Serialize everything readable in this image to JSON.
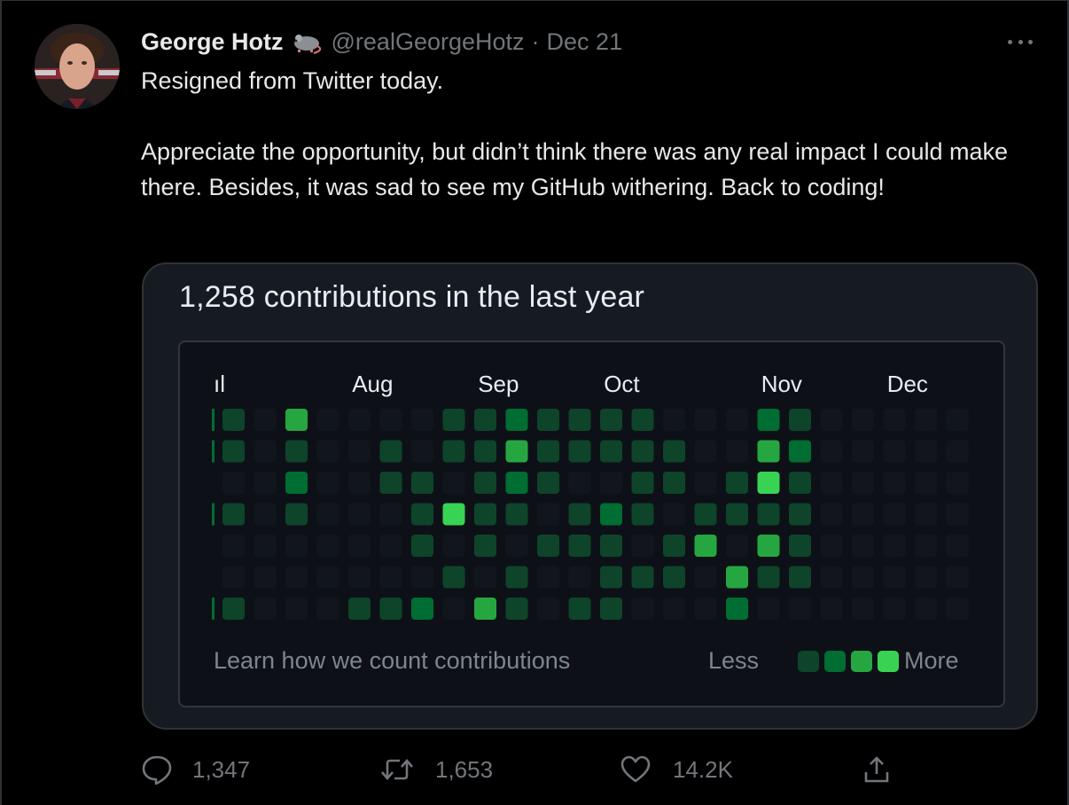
{
  "tweet": {
    "author_name": "George Hotz",
    "handle": "@realGeorgeHotz",
    "separator": "·",
    "date": "Dec 21",
    "paragraphs": [
      "Resigned from Twitter today.",
      "Appreciate the opportunity, but didn’t think there was any real impact I could make there. Besides, it was sad to see my GitHub withering. Back to coding!"
    ],
    "more_icon": "ellipsis-icon",
    "badge_icon": "rat-emoji-icon"
  },
  "github_card": {
    "title": "1,258 contributions in the last year",
    "months": [
      "ıl",
      "Aug",
      "Sep",
      "Oct",
      "Nov",
      "Dec"
    ],
    "learn_link": "Learn how we count contributions",
    "legend_less": "Less",
    "legend_more": "More",
    "colors": {
      "empty": "#161b22",
      "l1": "#0e4429",
      "l2": "#006d32",
      "l3": "#26a641",
      "l4": "#39d353"
    }
  },
  "chart_data": {
    "type": "heatmap",
    "title": "1,258 contributions in the last year",
    "x_labels": [
      "ıl",
      "Aug",
      "Sep",
      "Oct",
      "Nov",
      "Dec"
    ],
    "rows": 7,
    "weeks": 24,
    "levels": [
      [
        1,
        0,
        3,
        0,
        0,
        0,
        0,
        1,
        1,
        2,
        1,
        1,
        1,
        1,
        0,
        0,
        0,
        2,
        1,
        0,
        0,
        0,
        0,
        0
      ],
      [
        1,
        0,
        1,
        0,
        0,
        1,
        0,
        1,
        1,
        3,
        1,
        1,
        1,
        1,
        1,
        0,
        0,
        3,
        2,
        0,
        0,
        0,
        0,
        0
      ],
      [
        0,
        0,
        2,
        0,
        0,
        1,
        1,
        0,
        1,
        2,
        1,
        0,
        0,
        1,
        1,
        0,
        1,
        4,
        1,
        0,
        0,
        0,
        0,
        0
      ],
      [
        1,
        0,
        1,
        0,
        0,
        0,
        1,
        4,
        1,
        1,
        0,
        1,
        2,
        1,
        0,
        1,
        1,
        1,
        1,
        0,
        0,
        0,
        0,
        0
      ],
      [
        0,
        0,
        0,
        0,
        0,
        0,
        1,
        0,
        1,
        0,
        1,
        1,
        1,
        0,
        1,
        3,
        0,
        3,
        1,
        0,
        0,
        0,
        0,
        0
      ],
      [
        0,
        0,
        0,
        0,
        0,
        0,
        0,
        1,
        0,
        1,
        0,
        0,
        1,
        1,
        1,
        0,
        3,
        1,
        1,
        0,
        0,
        0,
        0,
        0
      ],
      [
        1,
        0,
        0,
        0,
        1,
        1,
        2,
        0,
        3,
        1,
        0,
        1,
        1,
        0,
        0,
        0,
        2,
        0,
        0,
        0,
        0,
        0,
        0,
        0
      ]
    ],
    "legend": [
      "Less",
      "More"
    ]
  },
  "actions": {
    "reply": {
      "icon": "reply-icon",
      "count": "1,347"
    },
    "retweet": {
      "icon": "retweet-icon",
      "count": "1,653"
    },
    "like": {
      "icon": "heart-icon",
      "count": "14.2K"
    },
    "share": {
      "icon": "share-icon"
    }
  }
}
